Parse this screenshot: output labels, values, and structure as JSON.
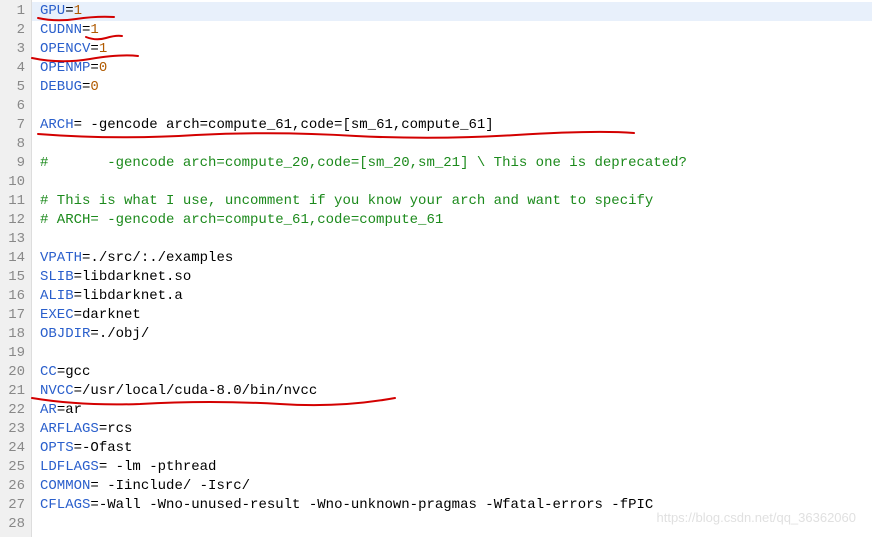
{
  "lines": [
    {
      "n": 1,
      "seg": [
        {
          "c": "kw",
          "t": "GPU"
        },
        {
          "c": "op",
          "t": "="
        },
        {
          "c": "num",
          "t": "1"
        }
      ]
    },
    {
      "n": 2,
      "seg": [
        {
          "c": "kw",
          "t": "CUDNN"
        },
        {
          "c": "op",
          "t": "="
        },
        {
          "c": "num",
          "t": "1"
        }
      ]
    },
    {
      "n": 3,
      "seg": [
        {
          "c": "kw",
          "t": "OPENCV"
        },
        {
          "c": "op",
          "t": "="
        },
        {
          "c": "num",
          "t": "1"
        }
      ]
    },
    {
      "n": 4,
      "seg": [
        {
          "c": "kw",
          "t": "OPENMP"
        },
        {
          "c": "op",
          "t": "="
        },
        {
          "c": "num",
          "t": "0"
        }
      ]
    },
    {
      "n": 5,
      "seg": [
        {
          "c": "kw",
          "t": "DEBUG"
        },
        {
          "c": "op",
          "t": "="
        },
        {
          "c": "num",
          "t": "0"
        }
      ]
    },
    {
      "n": 6,
      "seg": []
    },
    {
      "n": 7,
      "seg": [
        {
          "c": "kw",
          "t": "ARCH"
        },
        {
          "c": "op",
          "t": "= "
        },
        {
          "c": "txt",
          "t": "-gencode arch=compute_61,code=[sm_61,compute_61]"
        }
      ]
    },
    {
      "n": 8,
      "seg": []
    },
    {
      "n": 9,
      "seg": [
        {
          "c": "cmt",
          "t": "#       -gencode arch=compute_20,code=[sm_20,sm_21] \\ This one is deprecated?"
        }
      ]
    },
    {
      "n": 10,
      "seg": []
    },
    {
      "n": 11,
      "seg": [
        {
          "c": "cmt",
          "t": "# This is what I use, uncomment if you know your arch and want to specify"
        }
      ]
    },
    {
      "n": 12,
      "seg": [
        {
          "c": "cmt",
          "t": "# ARCH= -gencode arch=compute_61,code=compute_61"
        }
      ]
    },
    {
      "n": 13,
      "seg": []
    },
    {
      "n": 14,
      "seg": [
        {
          "c": "kw",
          "t": "VPATH"
        },
        {
          "c": "op",
          "t": "="
        },
        {
          "c": "txt",
          "t": "./src/:./examples"
        }
      ]
    },
    {
      "n": 15,
      "seg": [
        {
          "c": "kw",
          "t": "SLIB"
        },
        {
          "c": "op",
          "t": "="
        },
        {
          "c": "txt",
          "t": "libdarknet.so"
        }
      ]
    },
    {
      "n": 16,
      "seg": [
        {
          "c": "kw",
          "t": "ALIB"
        },
        {
          "c": "op",
          "t": "="
        },
        {
          "c": "txt",
          "t": "libdarknet.a"
        }
      ]
    },
    {
      "n": 17,
      "seg": [
        {
          "c": "kw",
          "t": "EXEC"
        },
        {
          "c": "op",
          "t": "="
        },
        {
          "c": "txt",
          "t": "darknet"
        }
      ]
    },
    {
      "n": 18,
      "seg": [
        {
          "c": "kw",
          "t": "OBJDIR"
        },
        {
          "c": "op",
          "t": "="
        },
        {
          "c": "txt",
          "t": "./obj/"
        }
      ]
    },
    {
      "n": 19,
      "seg": []
    },
    {
      "n": 20,
      "seg": [
        {
          "c": "kw",
          "t": "CC"
        },
        {
          "c": "op",
          "t": "="
        },
        {
          "c": "txt",
          "t": "gcc"
        }
      ]
    },
    {
      "n": 21,
      "seg": [
        {
          "c": "kw",
          "t": "NVCC"
        },
        {
          "c": "op",
          "t": "="
        },
        {
          "c": "txt",
          "t": "/usr/local/cuda-8.0/bin/nvcc"
        }
      ]
    },
    {
      "n": 22,
      "seg": [
        {
          "c": "kw",
          "t": "AR"
        },
        {
          "c": "op",
          "t": "="
        },
        {
          "c": "txt",
          "t": "ar"
        }
      ]
    },
    {
      "n": 23,
      "seg": [
        {
          "c": "kw",
          "t": "ARFLAGS"
        },
        {
          "c": "op",
          "t": "="
        },
        {
          "c": "txt",
          "t": "rcs"
        }
      ]
    },
    {
      "n": 24,
      "seg": [
        {
          "c": "kw",
          "t": "OPTS"
        },
        {
          "c": "op",
          "t": "="
        },
        {
          "c": "txt",
          "t": "-Ofast"
        }
      ]
    },
    {
      "n": 25,
      "seg": [
        {
          "c": "kw",
          "t": "LDFLAGS"
        },
        {
          "c": "op",
          "t": "= "
        },
        {
          "c": "txt",
          "t": "-lm -pthread"
        }
      ]
    },
    {
      "n": 26,
      "seg": [
        {
          "c": "kw",
          "t": "COMMON"
        },
        {
          "c": "op",
          "t": "= "
        },
        {
          "c": "txt",
          "t": "-Iinclude/ -Isrc/"
        }
      ]
    },
    {
      "n": 27,
      "seg": [
        {
          "c": "kw",
          "t": "CFLAGS"
        },
        {
          "c": "op",
          "t": "="
        },
        {
          "c": "txt",
          "t": "-Wall -Wno-unused-result -Wno-unknown-pragmas -Wfatal-errors -fPIC"
        }
      ]
    },
    {
      "n": 28,
      "seg": []
    }
  ],
  "highlighted_line": 1,
  "watermark": "https://blog.csdn.net/qq_36362060"
}
